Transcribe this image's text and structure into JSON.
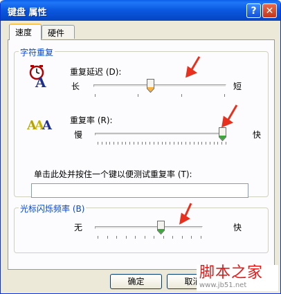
{
  "window": {
    "title": "键盘 属性"
  },
  "titlebar_buttons": {
    "help": "?",
    "close": "✕"
  },
  "tabs": [
    {
      "label": "速度",
      "active": true
    },
    {
      "label": "硬件",
      "active": false
    }
  ],
  "char_repeat": {
    "group_title": "字符重复",
    "repeat_delay": {
      "label": "重复延迟 (D):",
      "min_label": "长",
      "max_label": "短",
      "level": 0.42
    },
    "repeat_rate": {
      "label": "重复率 (R):",
      "min_label": "慢",
      "max_label": "快",
      "level": 1.0
    },
    "test_label": "单击此处并按住一个键以便测试重复率 (T):",
    "test_value": ""
  },
  "cursor_blink": {
    "group_title": "光标闪烁频率 (B)",
    "min_label": "无",
    "max_label": "快",
    "level": 0.62
  },
  "buttons": {
    "ok": "确定",
    "cancel": "取消"
  },
  "watermark": {
    "title": "脚本之家",
    "url": "www.jb51.net"
  },
  "colors": {
    "title_blue": "#0a57df",
    "group_title": "#0046d5",
    "arrow_red": "#e8301e",
    "slider_green": "#3ca83c"
  }
}
